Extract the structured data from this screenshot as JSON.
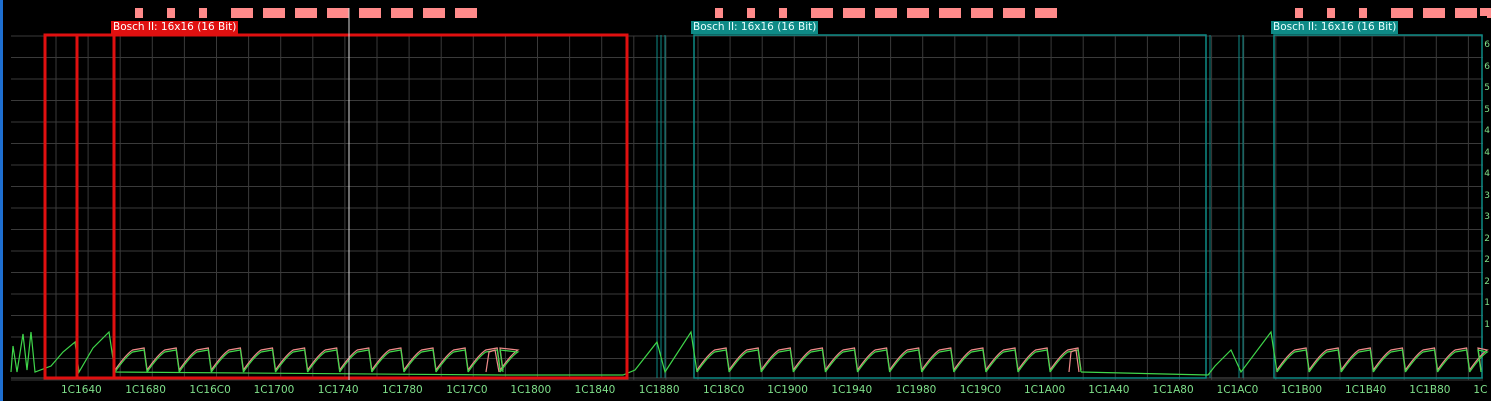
{
  "view": {
    "maps": [
      {
        "label": "Bosch II: 16x16 (16 Bit)",
        "state": "selected",
        "color": "#e01010"
      },
      {
        "label": "Bosch II: 16x16 (16 Bit)",
        "state": "normal",
        "color": "#0e8a86"
      },
      {
        "label": "Bosch II: 16x16 (16 Bit)",
        "state": "normal",
        "color": "#0e8a86"
      }
    ],
    "address_labels": [
      "1C1640",
      "1C1680",
      "1C16C0",
      "1C1700",
      "1C1740",
      "1C1780",
      "1C17C0",
      "1C1800",
      "1C1840",
      "1C1880",
      "1C18C0",
      "1C1900",
      "1C1940",
      "1C1980",
      "1C19C0",
      "1C1A00",
      "1C1A40",
      "1C1A80",
      "1C1AC0",
      "1C1B00",
      "1C1B40",
      "1C1B80",
      "1C"
    ],
    "y_ticks": [
      "6",
      "6",
      "5",
      "5",
      "4",
      "4",
      "4",
      "3",
      "3",
      "2",
      "2",
      "2",
      "1",
      "1"
    ],
    "colors": {
      "background": "#000000",
      "grid": "#3a3a3a",
      "signal": "#3fd64a",
      "secondary": "#f08a8a",
      "selected_map": "#e01010",
      "map_frame": "#0e8a86",
      "marker": "#ff8a8a",
      "window_border": "#1e6fd0"
    }
  }
}
